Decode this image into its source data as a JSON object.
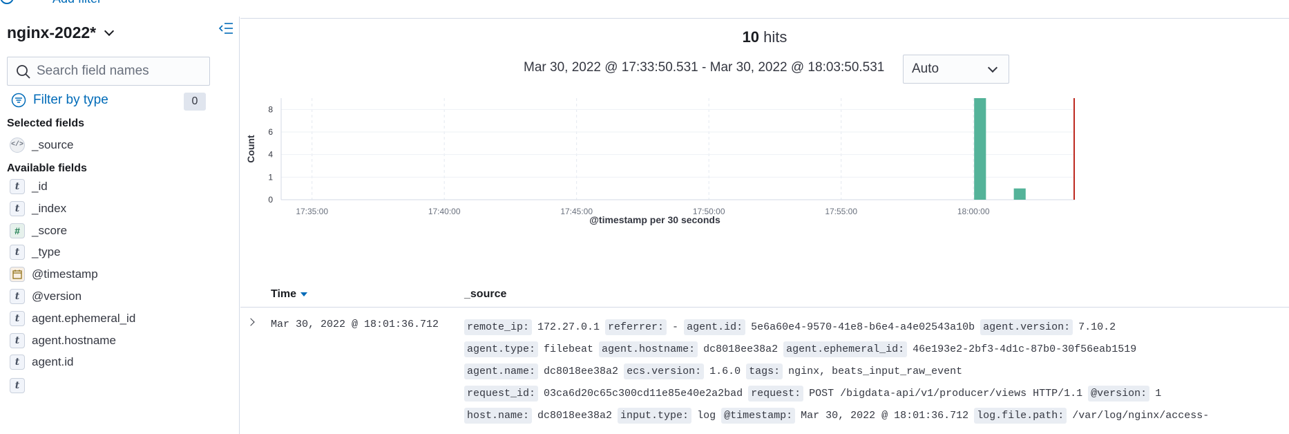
{
  "top_bar": {
    "add_filter_label": "Add filter"
  },
  "sidebar": {
    "index_pattern": "nginx-2022*",
    "search": {
      "placeholder": "Search field names",
      "value": ""
    },
    "filter_by_type": {
      "label": "Filter by type",
      "count": "0"
    },
    "selected_fields_title": "Selected fields",
    "selected_fields": [
      {
        "type_icon": "source-icon",
        "name": "_source"
      }
    ],
    "available_fields_title": "Available fields",
    "available_fields": [
      {
        "type": "t",
        "name": "_id"
      },
      {
        "type": "t",
        "name": "_index"
      },
      {
        "type": "#",
        "name": "_score"
      },
      {
        "type": "t",
        "name": "_type"
      },
      {
        "type": "date",
        "name": "@timestamp"
      },
      {
        "type": "t",
        "name": "@version"
      },
      {
        "type": "t",
        "name": "agent.ephemeral_id"
      },
      {
        "type": "t",
        "name": "agent.hostname"
      },
      {
        "type": "t",
        "name": "agent.id"
      }
    ]
  },
  "main": {
    "hits_count": "10",
    "hits_label": "hits",
    "time_range": "Mar 30, 2022 @ 17:33:50.531 - Mar 30, 2022 @ 18:03:50.531",
    "interval": "Auto",
    "table": {
      "col_time": "Time",
      "col_source": "_source",
      "row": {
        "time": "Mar 30, 2022 @ 18:01:36.712",
        "source_lines": [
          [
            {
              "k": "remote_ip:",
              "v": "172.27.0.1"
            },
            {
              "k": "referrer:",
              "v": "-"
            },
            {
              "k": "agent.id:",
              "v": "5e6a60e4-9570-41e8-b6e4-a4e02543a10b"
            },
            {
              "k": "agent.version:",
              "v": "7.10.2"
            }
          ],
          [
            {
              "k": "agent.type:",
              "v": "filebeat"
            },
            {
              "k": "agent.hostname:",
              "v": "dc8018ee38a2"
            },
            {
              "k": "agent.ephemeral_id:",
              "v": "46e193e2-2bf3-4d1c-87b0-30f56eab1519"
            }
          ],
          [
            {
              "k": "agent.name:",
              "v": "dc8018ee38a2"
            },
            {
              "k": "ecs.version:",
              "v": "1.6.0"
            },
            {
              "k": "tags:",
              "v": "nginx, beats_input_raw_event"
            }
          ],
          [
            {
              "k": "request_id:",
              "v": "03ca6d20c65c300cd11e85e40e2a2bad"
            },
            {
              "k": "request:",
              "v": "POST /bigdata-api/v1/producer/views HTTP/1.1"
            },
            {
              "k": "@version:",
              "v": "1"
            }
          ],
          [
            {
              "k": "host.name:",
              "v": "dc8018ee38a2"
            },
            {
              "k": "input.type:",
              "v": "log"
            },
            {
              "k": "@timestamp:",
              "v": "Mar 30, 2022 @ 18:01:36.712"
            },
            {
              "k": "log.file.path:",
              "v": "/var/log/nginx/access-"
            }
          ]
        ]
      }
    }
  },
  "colors": {
    "accent": "#006bb8",
    "bar": "#54b399",
    "now_marker": "#bd271e"
  },
  "chart_data": {
    "type": "bar",
    "title": "",
    "xlabel": "@timestamp per 30 seconds",
    "ylabel": "Count",
    "ylim": [
      0,
      9
    ],
    "y_ticks": [
      0,
      2,
      4,
      6,
      8
    ],
    "y_tick_labels": [
      "0",
      "1",
      "4",
      "6",
      "8"
    ],
    "x_ticks": [
      "17:35:00",
      "17:40:00",
      "17:45:00",
      "17:50:00",
      "17:55:00",
      "18:00:00"
    ],
    "x_range": [
      "17:33:50",
      "18:03:50"
    ],
    "bars": [
      {
        "x": "18:00:00",
        "value": 9
      },
      {
        "x": "18:01:30",
        "value": 1
      }
    ],
    "now_marker": "18:03:50",
    "grid": true
  }
}
